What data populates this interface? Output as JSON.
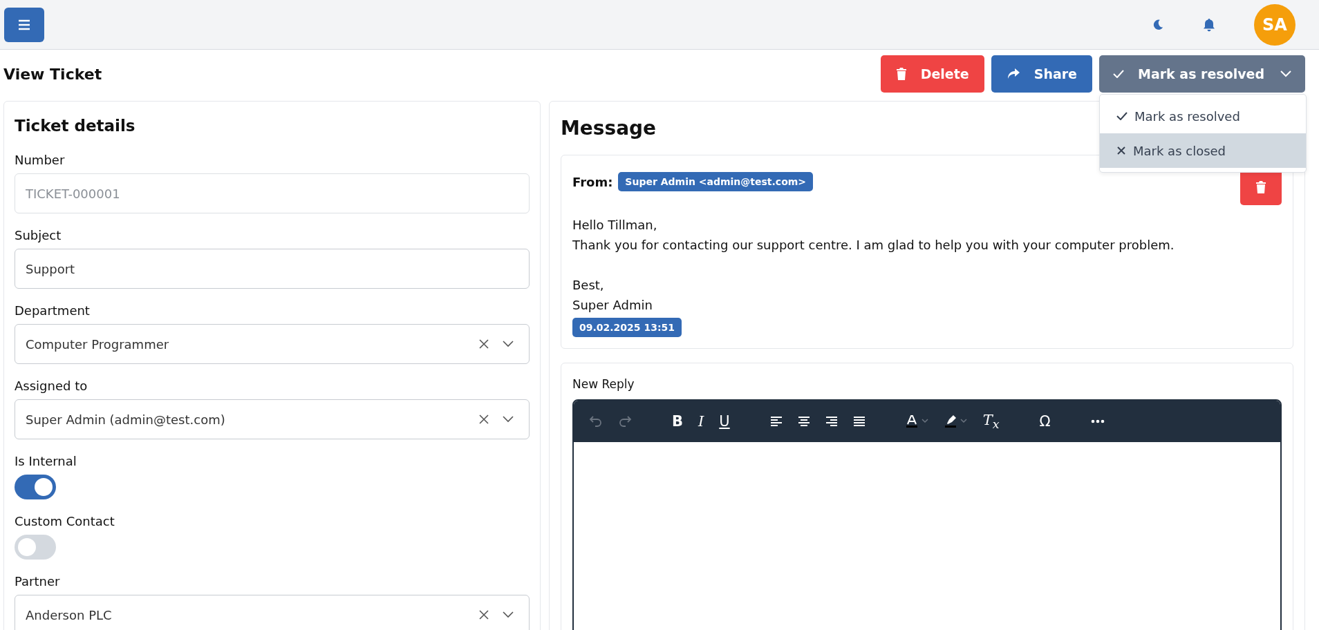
{
  "topbar": {
    "avatar": "SA"
  },
  "page": {
    "title": "View Ticket"
  },
  "actions": {
    "delete": "Delete",
    "share": "Share",
    "status": {
      "label": "Mark as resolved",
      "expanded": true,
      "menu": [
        {
          "label": "Mark as resolved",
          "kind": "check",
          "highlighted": false
        },
        {
          "label": "Mark as closed",
          "kind": "cross",
          "highlighted": true
        }
      ]
    }
  },
  "details": {
    "title": "Ticket details",
    "fields": [
      {
        "kind": "text",
        "label": "Number",
        "value": "TICKET-000001",
        "disabled": true
      },
      {
        "kind": "text",
        "label": "Subject",
        "value": "Support",
        "disabled": false
      },
      {
        "kind": "select",
        "label": "Department",
        "value": "Computer Programmer"
      },
      {
        "kind": "select",
        "label": "Assigned to",
        "value": "Super Admin (admin@test.com)"
      },
      {
        "kind": "toggle",
        "label": "Is Internal",
        "on": true
      },
      {
        "kind": "toggle",
        "label": "Custom Contact",
        "on": false
      },
      {
        "kind": "select",
        "label": "Partner",
        "value": "Anderson PLC"
      }
    ]
  },
  "message": {
    "title": "Message",
    "from_label": "From:",
    "from": "Super Admin <admin@test.com>",
    "paragraphs": [
      [
        "Hello Tillman,",
        "Thank you for contacting our support centre. I am glad to help you with your computer problem."
      ],
      [
        "Best,",
        "Super Admin"
      ]
    ],
    "date": "09.02.2025 13:51"
  },
  "reply": {
    "label": "New Reply",
    "glyphs": {
      "bold": "B",
      "italic": "I",
      "underline": "U",
      "clear": "T$_{x}$",
      "special": "Ω"
    }
  }
}
